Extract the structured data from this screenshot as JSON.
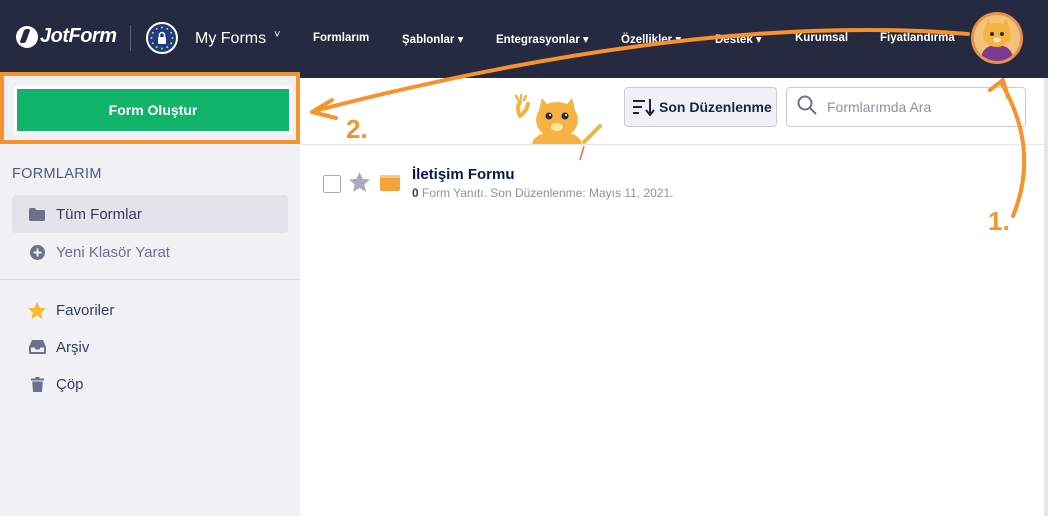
{
  "brand": {
    "name": "JotForm"
  },
  "header": {
    "workspace_label": "My Forms",
    "workspace_chevron": "˅",
    "nav": [
      {
        "label": "Formlarım"
      },
      {
        "label": "Şablonlar ▾"
      },
      {
        "label": "Entegrasyonlar ▾"
      },
      {
        "label": "Özellikler ▾"
      },
      {
        "label": "Destek ▾"
      },
      {
        "label": "Kurumsal"
      },
      {
        "label": "Fiyatlandırma"
      }
    ],
    "icons": [
      "lock-icon",
      "avatar"
    ]
  },
  "sidebar": {
    "create_button": "Form Oluştur",
    "section_title": "FORMLARIM",
    "folders": [
      {
        "label": "Tüm Formlar",
        "icon": "folder-icon",
        "active": true
      },
      {
        "label": "Yeni Klasör Yarat",
        "icon": "plus-circle-icon",
        "active": false
      }
    ],
    "extras": [
      {
        "label": "Favoriler",
        "icon": "star-icon"
      },
      {
        "label": "Arşiv",
        "icon": "inbox-icon"
      },
      {
        "label": "Çöp",
        "icon": "trash-icon"
      }
    ]
  },
  "toolbar": {
    "sort_label": "Son Düzenlenme",
    "search_placeholder": "Formlarımda Ara"
  },
  "forms": [
    {
      "title": "İletişim Formu",
      "response_count": "0",
      "meta_text": " Form Yanıtı. Son Düzenlenme: Mayıs 11, 2021."
    }
  ],
  "annotations": {
    "step1": "1.",
    "step2": "2.",
    "color": "#f7922c"
  },
  "colors": {
    "header_bg": "#262a40",
    "create_button": "#12b36a",
    "highlight": "#f7922c",
    "sidebar_bg": "#f1f1f5"
  }
}
